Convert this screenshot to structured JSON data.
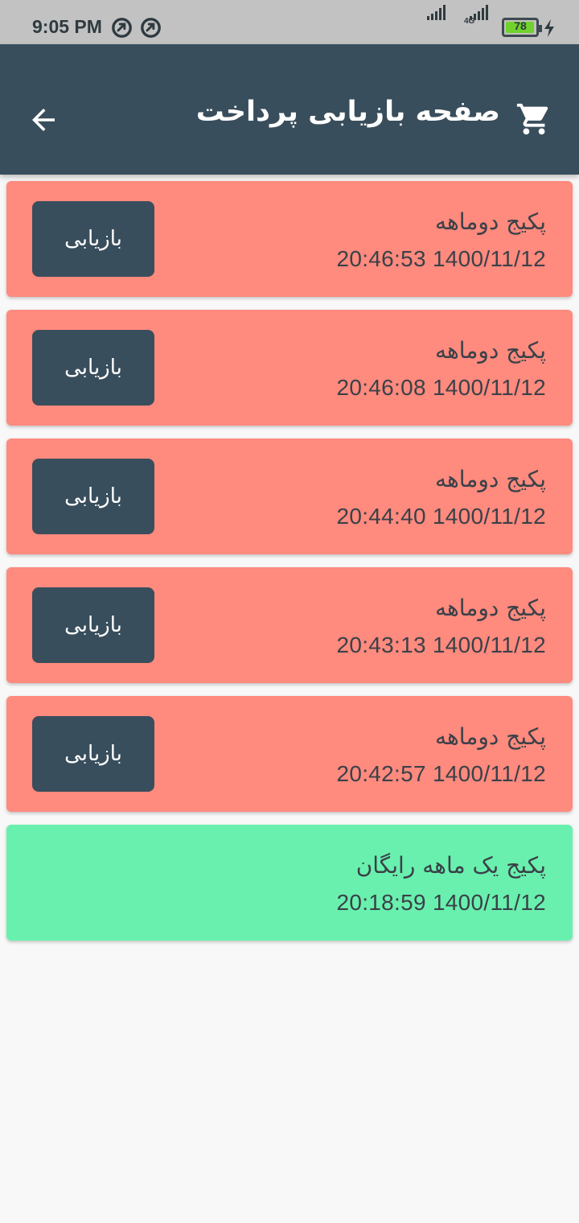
{
  "status_bar": {
    "time": "9:05 PM",
    "icons": [
      "vpn-circle-icon",
      "vpn-circle-icon"
    ],
    "network": "4G",
    "battery": "78"
  },
  "app_bar": {
    "title": "صفحه بازیابی پرداخت",
    "back_icon": "arrow-back-icon",
    "cart_icon": "shopping-cart-icon",
    "background": "#394e5c"
  },
  "colors": {
    "pending": "#ff8a7e",
    "free": "#69f0ae",
    "button": "#394e5c"
  },
  "items": [
    {
      "title": "پکیج دوماهه",
      "date": "20:46:53 1400/11/12",
      "status": "pending",
      "button_label": "بازیابی"
    },
    {
      "title": "پکیج دوماهه",
      "date": "20:46:08 1400/11/12",
      "status": "pending",
      "button_label": "بازیابی"
    },
    {
      "title": "پکیج دوماهه",
      "date": "20:44:40 1400/11/12",
      "status": "pending",
      "button_label": "بازیابی"
    },
    {
      "title": "پکیج دوماهه",
      "date": "20:43:13 1400/11/12",
      "status": "pending",
      "button_label": "بازیابی"
    },
    {
      "title": "پکیج دوماهه",
      "date": "20:42:57 1400/11/12",
      "status": "pending",
      "button_label": "بازیابی"
    },
    {
      "title": "پکیج یک ماهه رایگان",
      "date": "20:18:59 1400/11/12",
      "status": "free"
    }
  ]
}
